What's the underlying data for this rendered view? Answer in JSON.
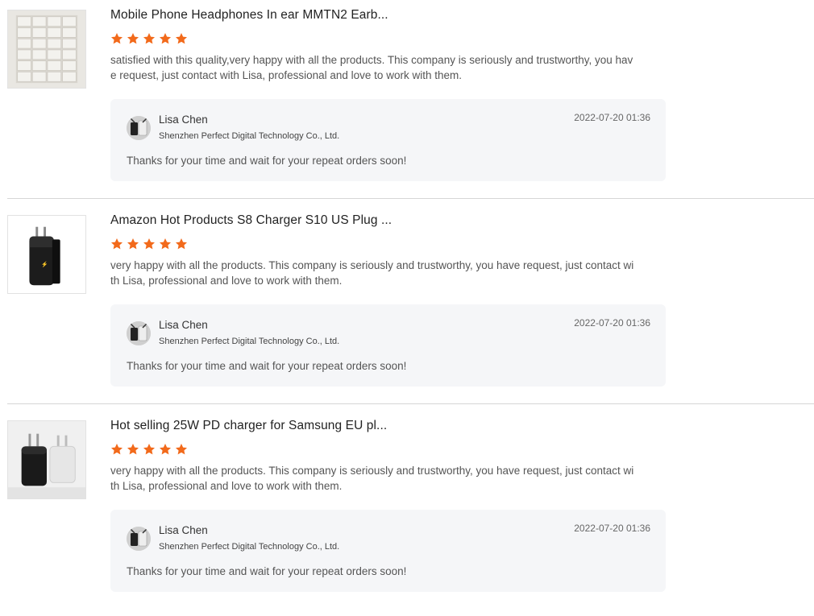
{
  "reviews": [
    {
      "title": "Mobile Phone Headphones In ear MMTN2 Earb...",
      "rating": 5,
      "text": "satisfied with this quality,very happy with all the products. This company is seriously and trustworthy, you have request, just contact with Lisa, professional and love to work with them.",
      "reply": {
        "name": "Lisa Chen",
        "company": "Shenzhen Perfect Digital Technology Co., Ltd.",
        "date": "2022-07-20 01:36",
        "text": "Thanks for your time and wait for your repeat orders soon!"
      }
    },
    {
      "title": "Amazon Hot Products S8 Charger S10 US Plug ...",
      "rating": 5,
      "text": "very happy with all the products. This company is seriously and trustworthy, you have request, just contact with Lisa, professional and love to work with them.",
      "reply": {
        "name": "Lisa Chen",
        "company": "Shenzhen Perfect Digital Technology Co., Ltd.",
        "date": "2022-07-20 01:36",
        "text": "Thanks for your time and wait for your repeat orders soon!"
      }
    },
    {
      "title": "Hot selling 25W PD charger for Samsung EU pl...",
      "rating": 5,
      "text": "very happy with all the products. This company is seriously and trustworthy, you have request, just contact with Lisa, professional and love to work with them.",
      "reply": {
        "name": "Lisa Chen",
        "company": "Shenzhen Perfect Digital Technology Co., Ltd.",
        "date": "2022-07-20 01:36",
        "text": "Thanks for your time and wait for your repeat orders soon!"
      }
    }
  ],
  "colors": {
    "star": "#f26a1b",
    "reply_bg": "#f5f6f8",
    "divider": "#d6d6d6"
  },
  "icons": {
    "star": "star-icon",
    "avatar": "seller-avatar"
  }
}
